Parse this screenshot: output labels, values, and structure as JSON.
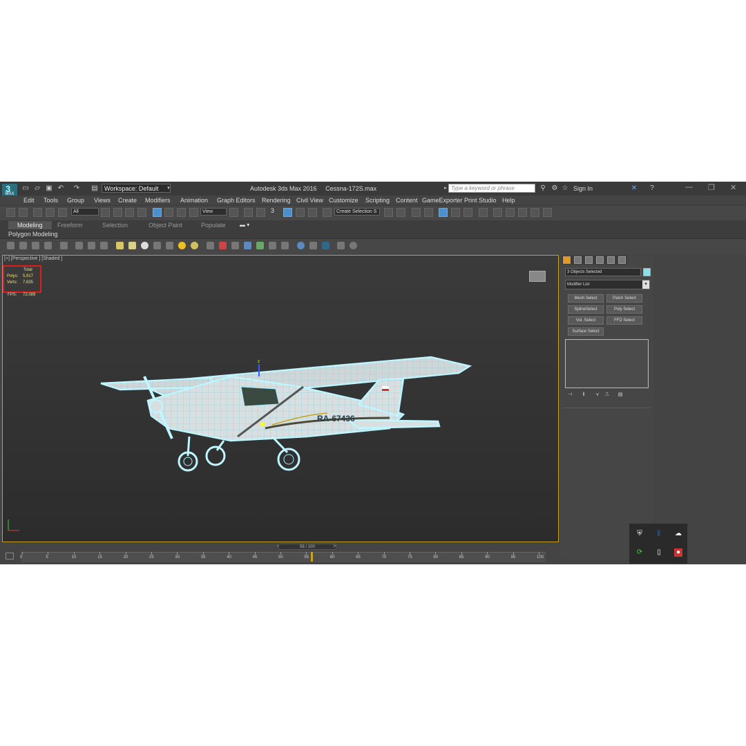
{
  "title_bar": {
    "logo_label": "MAX",
    "workspace": "Workspace: Default",
    "app_name": "Autodesk 3ds Max 2016",
    "file_name": "Cessna-172S.max",
    "search_placeholder": "Type a keyword or phrase",
    "sign_in": "Sign In"
  },
  "menu": [
    "Edit",
    "Tools",
    "Group",
    "Views",
    "Create",
    "Modifiers",
    "Animation",
    "Graph Editors",
    "Rendering",
    "Civil View",
    "Customize",
    "Scripting",
    "Content",
    "GameExporter",
    "Print Studio",
    "Help"
  ],
  "toolbar": {
    "selection_filter": "All",
    "reference_coord": "View",
    "snap_label": "3",
    "named_selection": "Create Selection S"
  },
  "ribbon": {
    "tabs": [
      "Modeling",
      "Freeform",
      "Selection",
      "Object Paint",
      "Populate"
    ],
    "active_tab": "Modeling",
    "panel_label": "Polygon Modeling"
  },
  "viewport": {
    "label": "[+] [Perspective ] [Shaded ]",
    "stats": {
      "header": "Total",
      "polys_label": "Polys:",
      "polys_value": "5,917",
      "verts_label": "Verts:",
      "verts_value": "7,635",
      "fps_label": "FPS:",
      "fps_value": "72.089"
    },
    "tail_number": "RA-67436"
  },
  "command_panel": {
    "selection_name": "3 Objects Selected",
    "modifier_list": "Modifier List",
    "modifier_buttons": [
      "Mesh Select",
      "Patch Select",
      "SplineSelect",
      "Poly Select",
      "Vol. Select",
      "FFD Select",
      "Surface Select"
    ]
  },
  "timeline": {
    "frame_counter": "56 / 100",
    "ticks": [
      "0",
      "5",
      "10",
      "15",
      "20",
      "25",
      "30",
      "35",
      "40",
      "45",
      "50",
      "55",
      "60",
      "65",
      "70",
      "75",
      "80",
      "85",
      "90",
      "95",
      "100"
    ]
  },
  "colors": {
    "viewport_border": "#c8a21d",
    "stats_box": "#e21b1b",
    "stats_text": "#f0e07a",
    "wireframe": "#9ff0ff",
    "color_swatch": "#8ee0e8"
  }
}
